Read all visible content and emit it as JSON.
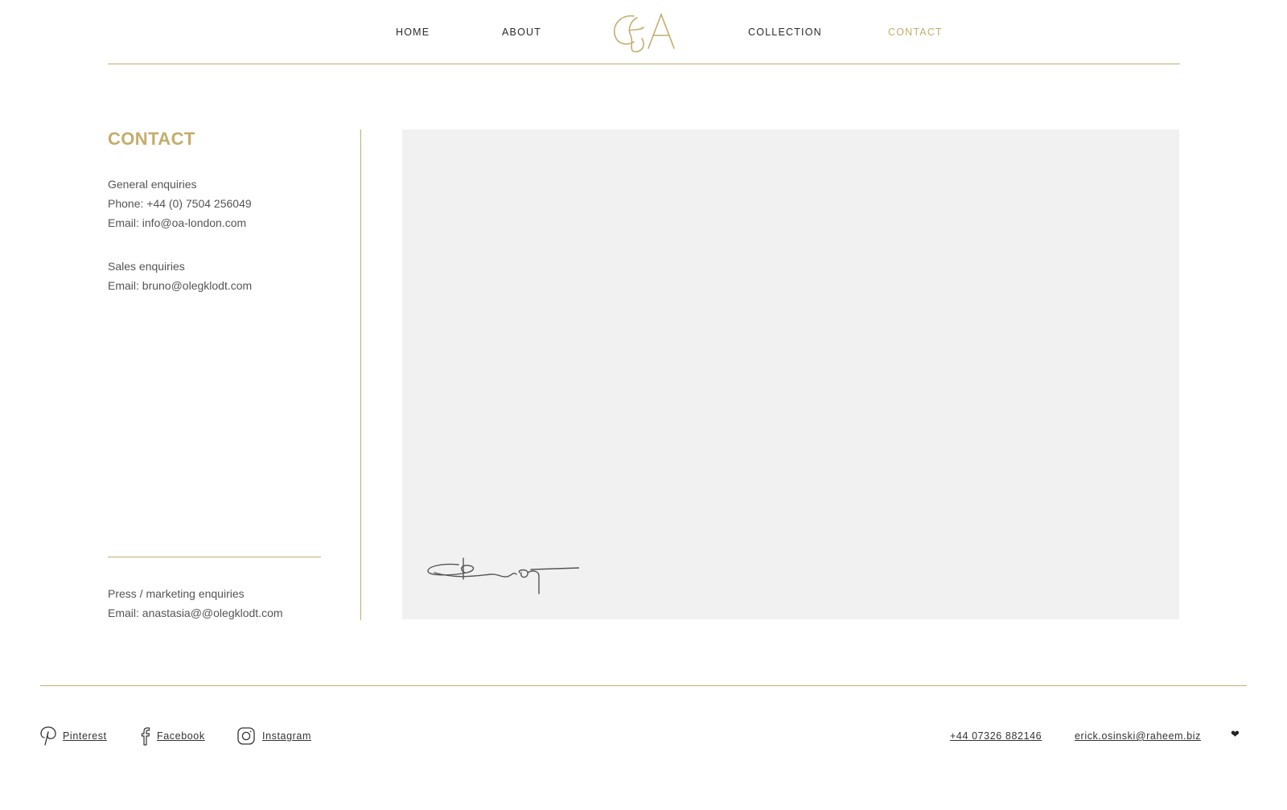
{
  "nav": {
    "home_label": "HOME",
    "about_label": "ABOUT",
    "collection_label": "COLLECTION",
    "contact_label": "CONTACT",
    "logo_text": "OA",
    "accent_color": "#c4ac6c"
  },
  "contact": {
    "title": "CONTACT",
    "general": {
      "heading": "General enquiries",
      "phone": "Phone: +44 (0) 7504 256049",
      "email": "Email: info@oa-london.com"
    },
    "sales": {
      "heading": "Sales enquiries",
      "email": "Email: bruno@olegklodt.com"
    },
    "press": {
      "heading": "Press / marketing enquiries",
      "email": "Email: anastasia@@olegklodt.com"
    }
  },
  "image_panel": {
    "background": "#f1f1f1",
    "signature_icon": "signature-icon"
  },
  "footer": {
    "social": [
      {
        "label": "Pinterest",
        "icon": "pinterest-icon"
      },
      {
        "label": "Facebook",
        "icon": "facebook-icon"
      },
      {
        "label": "Instagram",
        "icon": "instagram-icon"
      }
    ],
    "phone": "+44 07326 882146",
    "email": "erick.osinski@raheem.biz",
    "heart": "❤"
  }
}
